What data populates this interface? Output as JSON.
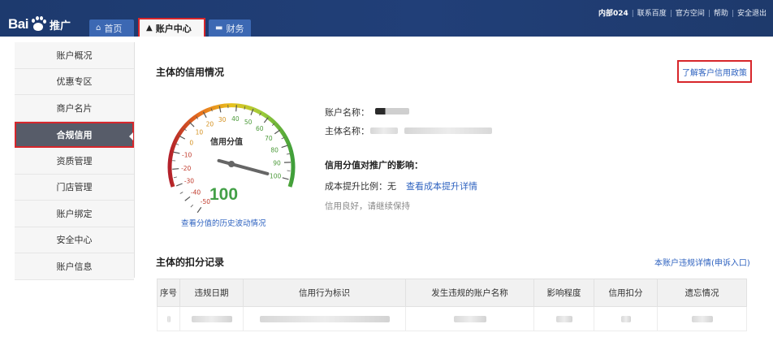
{
  "header": {
    "logo_text": "Bai",
    "logo_suffix": "推广",
    "tabs": [
      {
        "label": "首页",
        "icon": "home-icon"
      },
      {
        "label": "账户中心",
        "icon": "user-icon"
      },
      {
        "label": "财务",
        "icon": "card-icon"
      }
    ],
    "top_links": [
      "内部024",
      "联系百度",
      "官方空间",
      "帮助",
      "安全退出"
    ]
  },
  "sidebar": {
    "items": [
      {
        "label": "账户概况"
      },
      {
        "label": "优惠专区"
      },
      {
        "label": "商户名片"
      },
      {
        "label": "合规信用",
        "active": true
      },
      {
        "label": "资质管理"
      },
      {
        "label": "门店管理"
      },
      {
        "label": "账户绑定"
      },
      {
        "label": "安全中心"
      },
      {
        "label": "账户信息"
      }
    ]
  },
  "credit": {
    "title": "主体的信用情况",
    "policy_link": "了解客户信用政策",
    "gauge_label": "信用分值",
    "score": "100",
    "score_value": 100,
    "gauge_ticks": [
      "-50",
      "-40",
      "-30",
      "-20",
      "-10",
      "0",
      "10",
      "20",
      "30",
      "40",
      "50",
      "60",
      "70",
      "80",
      "90",
      "100"
    ],
    "history_link": "查看分值的历史波动情况",
    "account_name_label": "账户名称：",
    "entity_name_label": "主体名称：",
    "impact_title": "信用分值对推广的影响：",
    "cost_label": "成本提升比例：",
    "cost_value": "无",
    "cost_link": "查看成本提升详情",
    "status_text": "信用良好，请继续保持"
  },
  "deductions": {
    "title": "主体的扣分记录",
    "appeal_link": "本账户违规详情(申诉入口)",
    "columns": [
      "序号",
      "违规日期",
      "信用行为标识",
      "发生违规的账户名称",
      "影响程度",
      "信用扣分",
      "遗忘情况"
    ]
  },
  "colors": {
    "header_bg": "#213f78",
    "accent": "#2f63c0",
    "highlight": "#d7262b",
    "score": "#43a047"
  }
}
